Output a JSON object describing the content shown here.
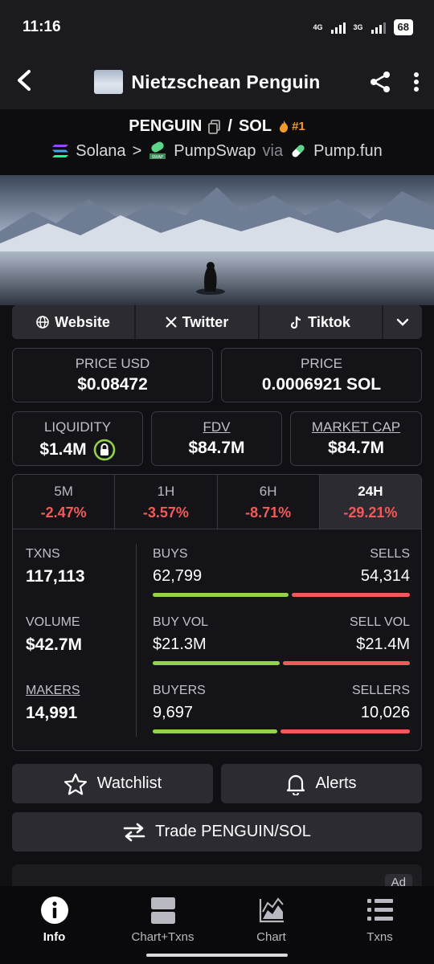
{
  "status_bar": {
    "time": "11:16",
    "network_1": "4G",
    "network_2": "3G",
    "battery": "68"
  },
  "header": {
    "title": "Nietzschean Penguin"
  },
  "pair": {
    "base": "PENGUIN",
    "separator": "/",
    "quote": "SOL",
    "rank": "#1",
    "chain": "Solana",
    "dex": "PumpSwap",
    "via": "via",
    "launchpad": "Pump.fun"
  },
  "social": {
    "website": "Website",
    "twitter": "Twitter",
    "tiktok": "Tiktok"
  },
  "price": {
    "usd_label": "PRICE USD",
    "usd_value": "$0.08472",
    "native_label": "PRICE",
    "native_value": "0.0006921 SOL"
  },
  "metrics": {
    "liquidity_label": "LIQUIDITY",
    "liquidity_value": "$1.4M",
    "fdv_label": "FDV",
    "fdv_value": "$84.7M",
    "mcap_label": "MARKET CAP",
    "mcap_value": "$84.7M"
  },
  "timeframes": [
    {
      "label": "5M",
      "change": "-2.47%"
    },
    {
      "label": "1H",
      "change": "-3.57%"
    },
    {
      "label": "6H",
      "change": "-8.71%"
    },
    {
      "label": "24H",
      "change": "-29.21%"
    }
  ],
  "stats": {
    "txns": {
      "label": "TXNS",
      "value": "117,113",
      "left_label": "BUYS",
      "left_value": "62,799",
      "right_label": "SELLS",
      "right_value": "54,314",
      "buy_share": 0.536
    },
    "volume": {
      "label": "VOLUME",
      "value": "$42.7M",
      "left_label": "BUY VOL",
      "left_value": "$21.3M",
      "right_label": "SELL VOL",
      "right_value": "$21.4M",
      "buy_share": 0.499
    },
    "makers": {
      "label": "MAKERS",
      "value": "14,991",
      "left_label": "BUYERS",
      "left_value": "9,697",
      "right_label": "SELLERS",
      "right_value": "10,026",
      "buy_share": 0.492
    }
  },
  "actions": {
    "watchlist": "Watchlist",
    "alerts": "Alerts",
    "trade": "Trade PENGUIN/SOL"
  },
  "ad_label": "Ad",
  "nav": [
    {
      "label": "Info",
      "icon": "info-icon",
      "active": true
    },
    {
      "label": "Chart+Txns",
      "icon": "split-view-icon",
      "active": false
    },
    {
      "label": "Chart",
      "icon": "area-chart-icon",
      "active": false
    },
    {
      "label": "Txns",
      "icon": "list-icon",
      "active": false
    }
  ],
  "colors": {
    "positive": "#93d24a",
    "negative": "#f25a5a",
    "rank": "#f29b2c"
  }
}
